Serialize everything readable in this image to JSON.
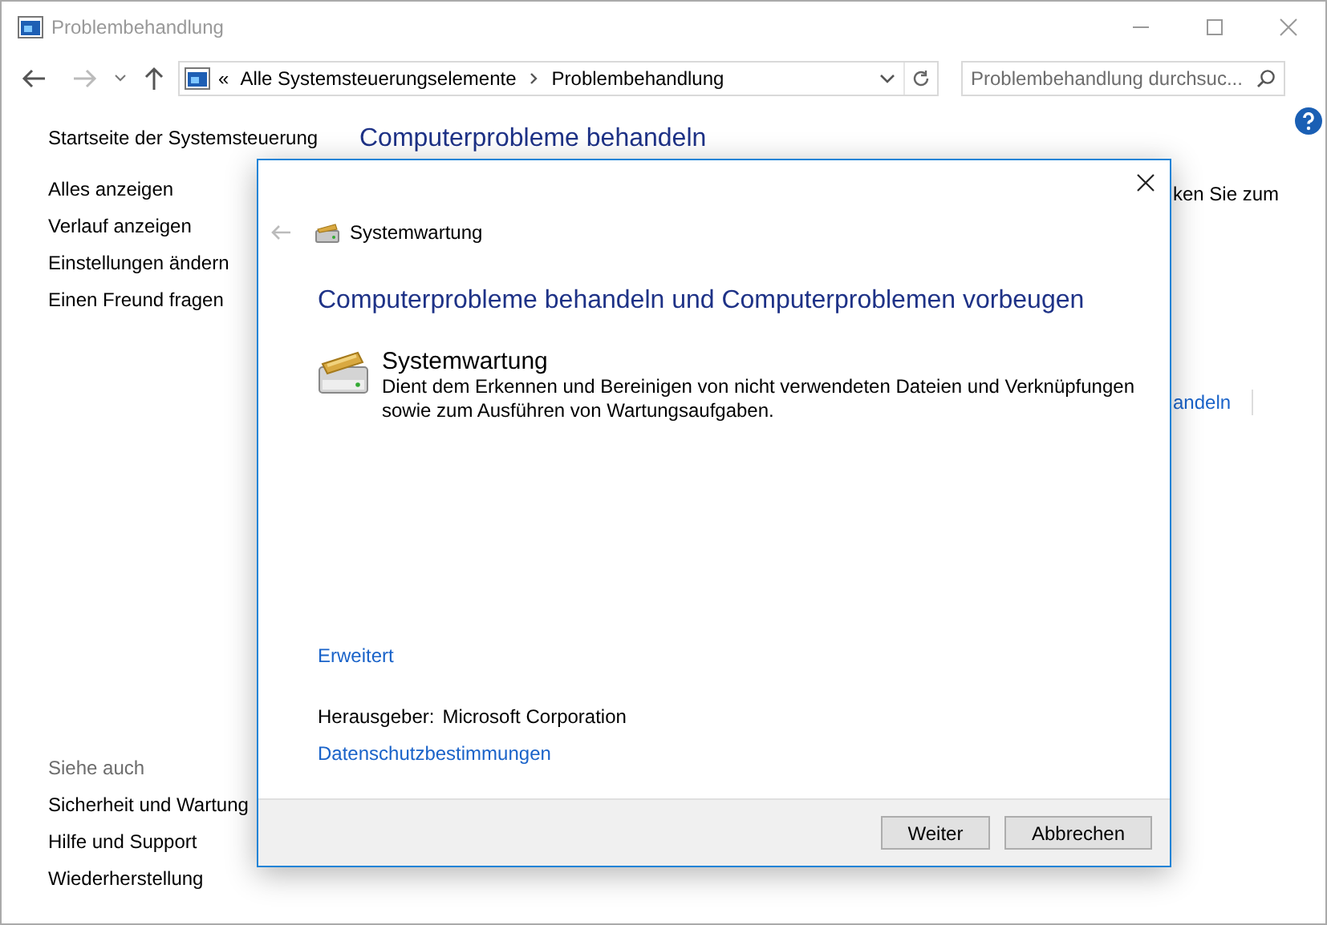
{
  "window": {
    "title": "Problembehandlung"
  },
  "address_bar": {
    "overflow": "«",
    "path": [
      {
        "label": "Alle Systemsteuerungselemente"
      },
      {
        "label": "Problembehandlung"
      }
    ]
  },
  "search": {
    "placeholder": "Problembehandlung durchsuc..."
  },
  "sidebar": {
    "home": "Startseite der Systemsteuerung",
    "items": [
      {
        "label": "Alles anzeigen"
      },
      {
        "label": "Verlauf anzeigen"
      },
      {
        "label": "Einstellungen ändern"
      },
      {
        "label": "Einen Freund fragen"
      }
    ],
    "see_also": {
      "heading": "Siehe auch",
      "items": [
        {
          "label": "Sicherheit und Wartung"
        },
        {
          "label": "Hilfe und Support"
        },
        {
          "label": "Wiederherstellung"
        }
      ]
    }
  },
  "main": {
    "heading": "Computerprobleme behandeln",
    "fragment_1": "ken Sie zum",
    "fragment_2": "andeln"
  },
  "dialog": {
    "title": "Systemwartung",
    "heading": "Computerprobleme behandeln und Computerproblemen vorbeugen",
    "item": {
      "title": "Systemwartung",
      "description": "Dient dem Erkennen und Bereinigen von nicht verwendeten Dateien und Verknüpfungen sowie zum Ausführen von Wartungsaufgaben."
    },
    "advanced": "Erweitert",
    "publisher_label": "Herausgeber:",
    "publisher": "Microsoft Corporation",
    "privacy": "Datenschutzbestimmungen",
    "buttons": [
      {
        "label": "Weiter",
        "kind": "default"
      },
      {
        "label": "Abbrechen",
        "kind": "normal"
      }
    ]
  }
}
